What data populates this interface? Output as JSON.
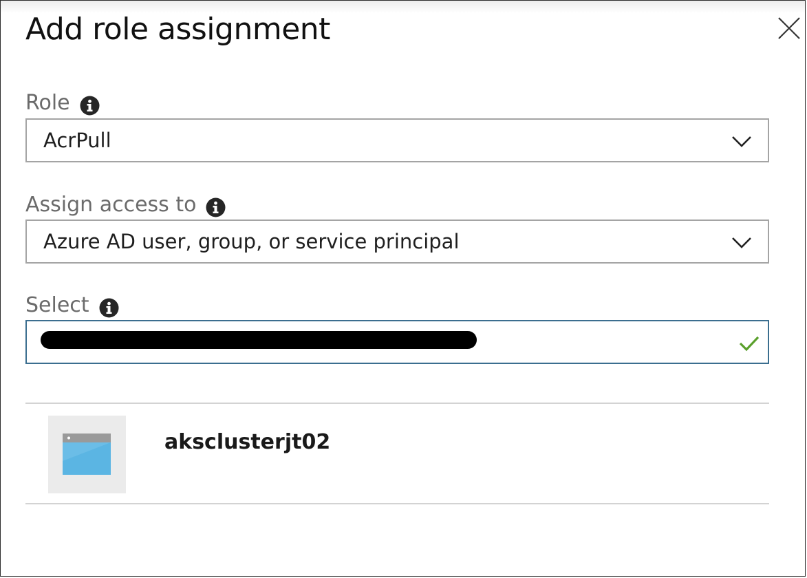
{
  "blade": {
    "title": "Add role assignment",
    "close_icon": "close-icon"
  },
  "role": {
    "label": "Role",
    "info_icon": "info-icon",
    "value": "AcrPull",
    "chevron_icon": "chevron-down-icon"
  },
  "assign_access": {
    "label": "Assign access to",
    "info_icon": "info-icon",
    "value": "Azure AD user, group, or service principal",
    "chevron_icon": "chevron-down-icon"
  },
  "select": {
    "label": "Select",
    "info_icon": "info-icon",
    "value": "",
    "value_redacted": true,
    "validation_icon": "checkmark-icon"
  },
  "results": [
    {
      "name": "aksclusterjt02",
      "icon": "app-window-icon"
    }
  ],
  "colors": {
    "input_focus_border": "#3b6e8f",
    "valid_check": "#5aa02c",
    "icon_blue": "#5bb5e3",
    "label_gray": "#6b6b6b"
  }
}
